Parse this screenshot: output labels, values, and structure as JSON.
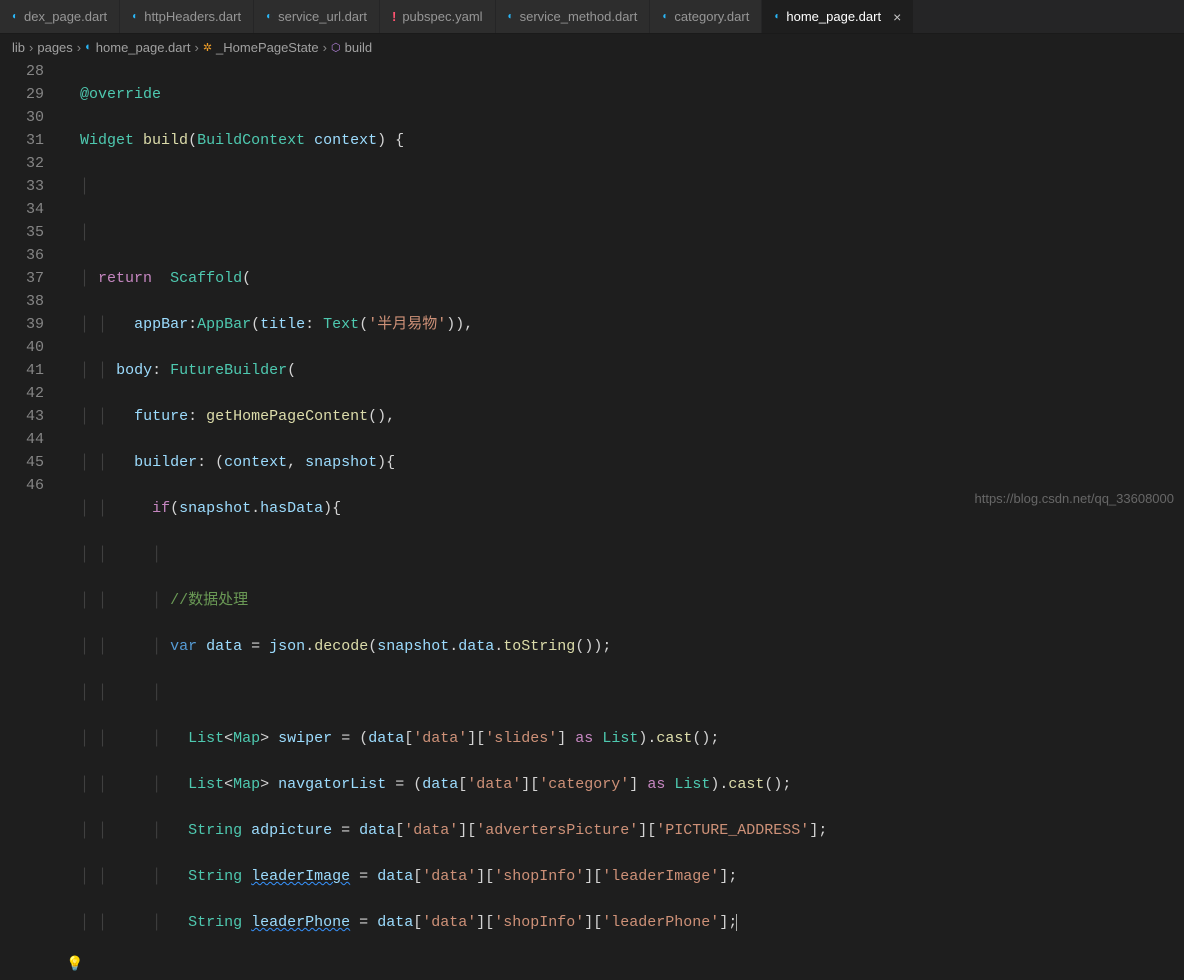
{
  "tabs": [
    {
      "label": "dex_page.dart",
      "icon": "dart"
    },
    {
      "label": "httpHeaders.dart",
      "icon": "dart"
    },
    {
      "label": "service_url.dart",
      "icon": "dart"
    },
    {
      "label": "pubspec.yaml",
      "icon": "yaml"
    },
    {
      "label": "service_method.dart",
      "icon": "dart"
    },
    {
      "label": "category.dart",
      "icon": "dart"
    },
    {
      "label": "home_page.dart",
      "icon": "dart",
      "active": true,
      "closable": true
    }
  ],
  "breadcrumb": {
    "items": [
      "lib",
      "pages",
      "home_page.dart",
      "_HomePageState",
      "build"
    ]
  },
  "lineNumbers": [
    "28",
    "29",
    "30",
    "31",
    "32",
    "33",
    "34",
    "35",
    "36",
    "37",
    "38",
    "39",
    "40",
    "41",
    "42",
    "43",
    "44",
    "45",
    "46"
  ],
  "code": {
    "l28": {
      "override": "@override"
    },
    "l29": {
      "widget": "Widget",
      "build": "build",
      "ctxType": "BuildContext",
      "ctx": "context"
    },
    "l32": {
      "ret": "return",
      "scaffold": "Scaffold"
    },
    "l33": {
      "appBar": "appBar",
      "AppBar": "AppBar",
      "title": "title",
      "Text": "Text",
      "str": "'半月易物'"
    },
    "l34": {
      "body": "body",
      "FutureBuilder": "FutureBuilder"
    },
    "l35": {
      "future": "future",
      "fn": "getHomePageContent"
    },
    "l36": {
      "builder": "builder",
      "ctx": "context",
      "snap": "snapshot"
    },
    "l37": {
      "if": "if",
      "snap": "snapshot",
      "hasData": "hasData"
    },
    "l39": {
      "cmt": "//数据处理"
    },
    "l40": {
      "var": "var",
      "data": "data",
      "json": "json",
      "decode": "decode",
      "snap": "snapshot",
      "dataProp": "data",
      "toString": "toString"
    },
    "l42": {
      "List": "List",
      "Map": "Map",
      "swiper": "swiper",
      "data": "data",
      "k1": "'data'",
      "k2": "'slides'",
      "as": "as",
      "ListT": "List",
      "cast": "cast"
    },
    "l43": {
      "List": "List",
      "Map": "Map",
      "nav": "navgatorList",
      "data": "data",
      "k1": "'data'",
      "k2": "'category'",
      "as": "as",
      "ListT": "List",
      "cast": "cast"
    },
    "l44": {
      "String": "String",
      "adpicture": "adpicture",
      "data": "data",
      "k1": "'data'",
      "k2": "'advertersPicture'",
      "k3": "'PICTURE_ADDRESS'"
    },
    "l45": {
      "String": "String",
      "var": "leaderImage",
      "data": "data",
      "k1": "'data'",
      "k2": "'shopInfo'",
      "k3": "'leaderImage'"
    },
    "l46": {
      "String": "String",
      "var": "leaderPhone",
      "data": "data",
      "k1": "'data'",
      "k2": "'shopInfo'",
      "k3": "'leaderPhone'"
    }
  },
  "watermark": "https://blog.csdn.net/qq_33608000",
  "icons": {
    "yaml": "!",
    "close": "×",
    "chev": "›",
    "bulb": "💡"
  }
}
